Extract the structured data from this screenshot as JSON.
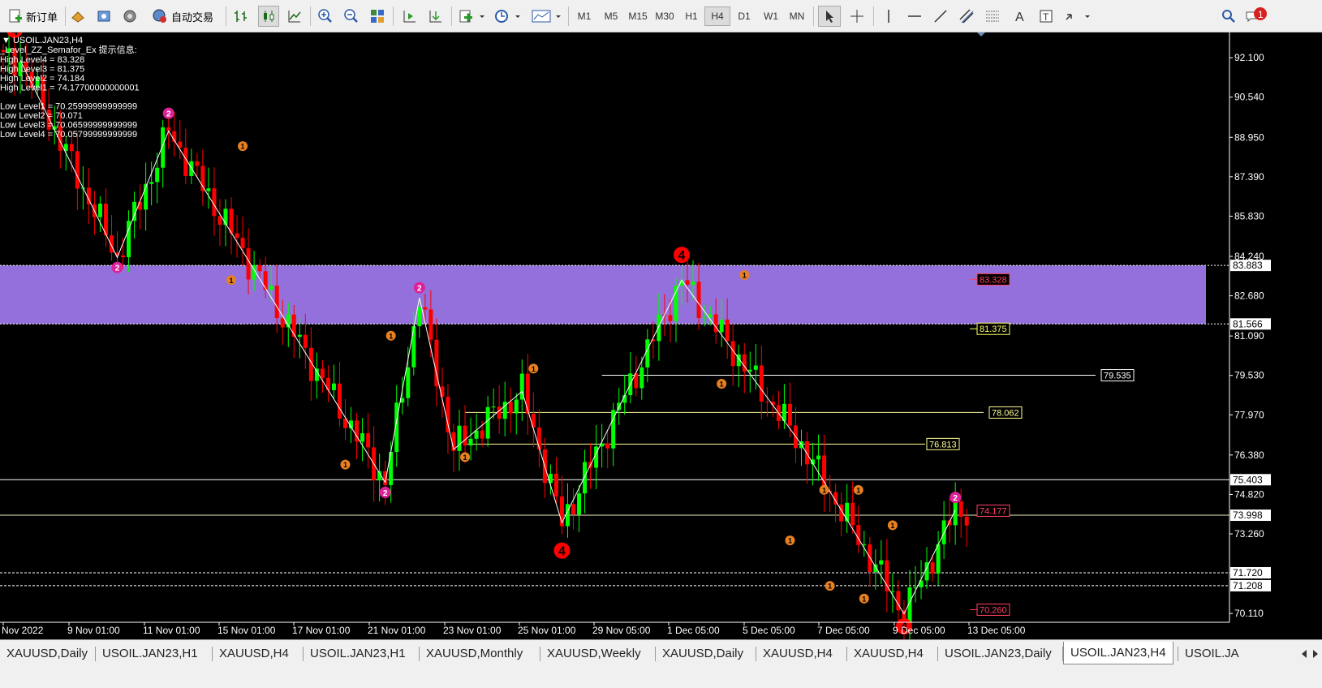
{
  "toolbar": {
    "new_order_label": "新订单",
    "auto_trade_label": "自动交易",
    "timeframes": [
      "M1",
      "M5",
      "M15",
      "M30",
      "H1",
      "H4",
      "D1",
      "W1",
      "MN"
    ],
    "active_timeframe": "H4",
    "notification_count": "1"
  },
  "chart": {
    "symbol_label": "USOIL.JAN23,H4",
    "indicator_title": "_Level_ZZ_Semafor_Ex 提示信息:",
    "info_lines": [
      "High Level4 = 83.328",
      "High Level3 = 81.375",
      "High Level2 = 74.184",
      "High Level1 = 74.17700000000001",
      "",
      "Low Level1 = 70.25999999999999",
      "Low Level2 = 70.071",
      "Low Level3 = 70.06599999999999",
      "Low Level4 = 70.05799999999999"
    ],
    "colors": {
      "bull": "#00ff00",
      "bear": "#ff0000",
      "zone": "#9370db",
      "grid_text": "#ffffff",
      "semafor1": "#e68020",
      "semafor2": "#dd2299",
      "semafor4": "#ff0000"
    },
    "price_axis": [
      "92.100",
      "90.540",
      "88.950",
      "87.390",
      "85.830",
      "84.240",
      "82.680",
      "81.090",
      "79.530",
      "77.970",
      "76.380",
      "74.820",
      "73.260",
      "71.720",
      "70.110"
    ],
    "price_tags": [
      {
        "text": "83.883",
        "price": 83.883,
        "style": "white"
      },
      {
        "text": "81.566",
        "price": 81.566,
        "style": "white"
      },
      {
        "text": "75.403",
        "price": 75.403,
        "style": "white"
      },
      {
        "text": "73.998",
        "price": 73.998,
        "style": "white"
      },
      {
        "text": "71.720",
        "price": 71.72,
        "style": "white"
      },
      {
        "text": "71.208",
        "price": 71.208,
        "style": "white"
      }
    ],
    "level_labels": [
      {
        "text": "83.328",
        "price": 83.328,
        "color": "#ff4060"
      },
      {
        "text": "81.375",
        "price": 81.375,
        "color": "#ffff66"
      },
      {
        "text": "79.535",
        "price": 79.535,
        "color": "#ffffff"
      },
      {
        "text": "78.062",
        "price": 78.062,
        "color": "#ffff99"
      },
      {
        "text": "76.813",
        "price": 76.813,
        "color": "#ffff99"
      },
      {
        "text": "74.177",
        "price": 74.177,
        "color": "#ff4060"
      },
      {
        "text": "70.260",
        "price": 70.26,
        "color": "#ff4060"
      }
    ],
    "time_axis": [
      "Nov 2022",
      "9 Nov 01:00",
      "11 Nov 01:00",
      "15 Nov 01:00",
      "17 Nov 01:00",
      "21 Nov 01:00",
      "23 Nov 01:00",
      "25 Nov 01:00",
      "29 Nov 05:00",
      "1 Dec 05:00",
      "5 Dec 05:00",
      "7 Dec 05:00",
      "9 Dec 05:00",
      "13 Dec 05:00"
    ]
  },
  "chart_data": {
    "type": "candlestick",
    "zigzag": [
      {
        "bar": 3,
        "price": 92.0
      },
      {
        "bar": 20,
        "price": 84.2
      },
      {
        "bar": 29,
        "price": 89.2
      },
      {
        "bar": 67,
        "price": 75.3
      },
      {
        "bar": 73,
        "price": 82.6
      },
      {
        "bar": 79,
        "price": 76.6
      },
      {
        "bar": 91,
        "price": 78.9
      },
      {
        "bar": 98,
        "price": 73.7
      },
      {
        "bar": 119,
        "price": 83.3
      },
      {
        "bar": 140,
        "price": 76.8
      },
      {
        "bar": 158,
        "price": 70.1
      },
      {
        "bar": 167,
        "price": 74.2
      }
    ],
    "semafors": [
      {
        "bar": 2,
        "price": 93.2,
        "level": 4
      },
      {
        "bar": 20,
        "price": 83.8,
        "level": 2
      },
      {
        "bar": 29,
        "price": 89.9,
        "level": 2
      },
      {
        "bar": 42,
        "price": 88.6,
        "level": 1
      },
      {
        "bar": 40,
        "price": 83.3,
        "level": 1
      },
      {
        "bar": 67,
        "price": 74.9,
        "level": 2
      },
      {
        "bar": 73,
        "price": 83.0,
        "level": 2
      },
      {
        "bar": 60,
        "price": 76.0,
        "level": 1
      },
      {
        "bar": 68,
        "price": 81.1,
        "level": 1
      },
      {
        "bar": 81,
        "price": 76.3,
        "level": 1
      },
      {
        "bar": 93,
        "price": 79.8,
        "level": 1
      },
      {
        "bar": 98,
        "price": 72.6,
        "level": 4
      },
      {
        "bar": 119,
        "price": 84.3,
        "level": 4
      },
      {
        "bar": 130,
        "price": 83.5,
        "level": 1
      },
      {
        "bar": 126,
        "price": 79.2,
        "level": 1
      },
      {
        "bar": 138,
        "price": 73.0,
        "level": 1
      },
      {
        "bar": 144,
        "price": 75.0,
        "level": 1
      },
      {
        "bar": 150,
        "price": 75.0,
        "level": 1
      },
      {
        "bar": 145,
        "price": 71.2,
        "level": 1
      },
      {
        "bar": 151,
        "price": 70.7,
        "level": 1
      },
      {
        "bar": 156,
        "price": 73.6,
        "level": 1
      },
      {
        "bar": 158,
        "price": 69.6,
        "level": 4
      },
      {
        "bar": 167,
        "price": 74.7,
        "level": 2
      }
    ],
    "zone": {
      "top": 83.883,
      "bottom": 81.566
    },
    "y_range": [
      69.5,
      93.1
    ]
  }
}
